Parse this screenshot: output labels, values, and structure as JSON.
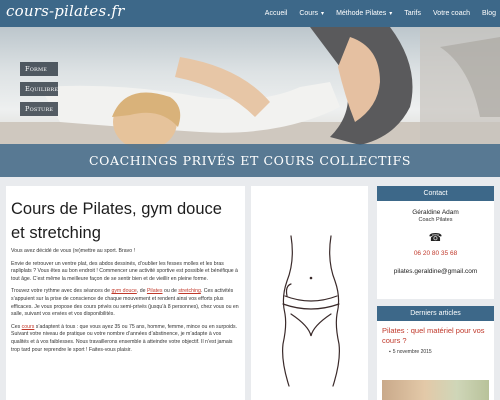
{
  "logo": "cours-pilates.fr",
  "nav": {
    "items": [
      {
        "label": "Accueil",
        "dropdown": false
      },
      {
        "label": "Cours",
        "dropdown": true
      },
      {
        "label": "Méthode Pilates",
        "dropdown": true
      },
      {
        "label": "Tarifs",
        "dropdown": false
      },
      {
        "label": "Votre coach",
        "dropdown": false
      },
      {
        "label": "Blog",
        "dropdown": false
      }
    ]
  },
  "hero": {
    "menu": [
      "Forme",
      "Equilibre",
      "Posture"
    ],
    "banner": "COACHINGS PRIVÉS ET COURS COLLECTIFS"
  },
  "article": {
    "title": "Cours de Pilates, gym douce et stretching",
    "p1": "Vous avez décidé de vous (re)mettre au sport. Bravo !",
    "p2": "Envie de retrouver un ventre plat, des abdos dessinés, d’oublier les fesses molles et les bras rapliplats ? Vous êtes au bon endroit ! Commencer une activité sportive est possible et bénéfique à tout âge. C’est même la meilleure façon de se sentir bien et de vieillir en pleine forme.",
    "p3_a": "Trouvez votre rythme avec des séances de ",
    "p3_link1": "gym douce",
    "p3_b": ", de ",
    "p3_link2": "Pilates",
    "p3_c": " ou de ",
    "p3_link3": "stretching",
    "p3_d": ". Ces activités s’appuient sur la prise de conscience de chaque mouvement et rendent ainsi vos efforts plus efficaces. Je vous propose des cours privés ou semi-privés (jusqu’à 8 personnes), chez vous ou en salle, suivant vos envies et vos disponibilités.",
    "p4_a": "Ces ",
    "p4_link": "cours",
    "p4_b": " s’adaptent à tous : que vous ayez 35 ou 75 ans, homme, femme, mince ou en surpoids. Suivant votre niveau de pratique ou votre nombre d’années d’abstinence, je m’adapte à vos qualités et à vos faiblesses. Nous travaillerons ensemble à atteindre votre objectif. Il n’est jamais trop tard pour reprendre le sport ! Faites-vous plaisir."
  },
  "contact": {
    "heading": "Contact",
    "name": "Géraldine Adam",
    "role": "Coach Pilates",
    "phone_icon": "☎",
    "phone": "06 20 80 35 68",
    "email": "pilates.geraldine@gmail.com"
  },
  "latest": {
    "heading": "Derniers articles",
    "title": "Pilates : quel matériel pour vos cours ?",
    "date": "5 novembre 2015"
  },
  "colors": {
    "brand": "#3d6889",
    "link": "#c0392b",
    "background": "#e9ebee"
  },
  "icons": {
    "phone": "telephone-icon",
    "calendar": "calendar-icon",
    "caret": "chevron-down-icon"
  }
}
